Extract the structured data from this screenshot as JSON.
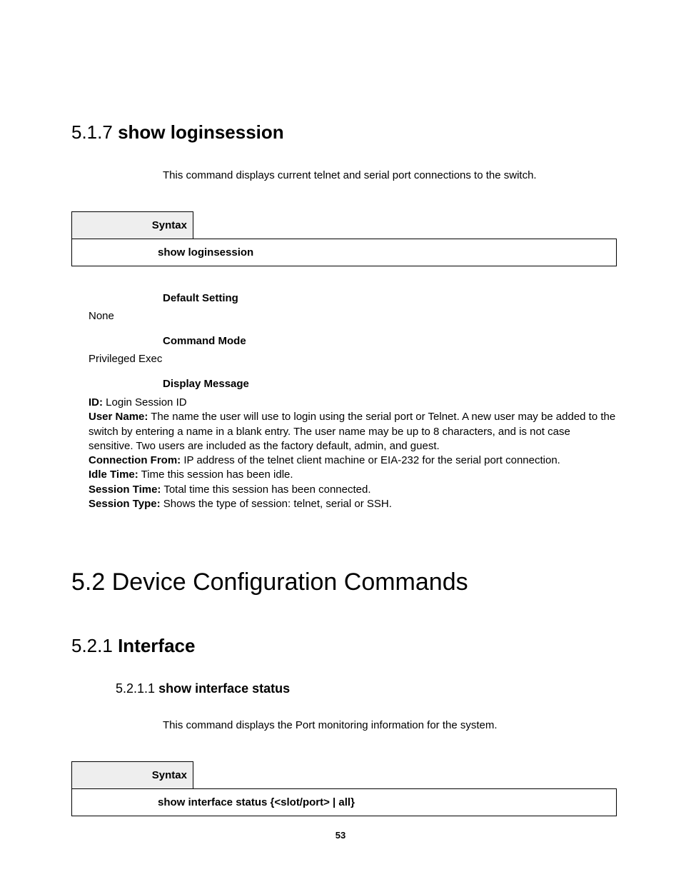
{
  "sec517": {
    "num": "5.1.7",
    "title": "show loginsession",
    "desc": "This command displays current telnet and serial port connections to the switch.",
    "syntax_label": "Syntax",
    "syntax_body": "show loginsession",
    "default_label": "Default Setting",
    "default_value": "None",
    "mode_label": "Command Mode",
    "mode_value": "Privileged Exec",
    "display_label": "Display Message",
    "msgs": {
      "id_k": "ID:",
      "id_v": " Login Session ID",
      "user_k": "User Name:",
      "user_v": " The name the user will use to login using the serial port or Telnet. A new user may be added to the switch by entering a name in a blank entry. The user name may be up to 8 characters, and is not case sensitive. Two users are included as the factory default, admin, and guest.",
      "conn_k": "Connection From:",
      "conn_v": " IP address of the telnet client machine or EIA-232 for the serial port connection.",
      "idle_k": "Idle Time:",
      "idle_v": " Time this session has been idle.",
      "sess_k": "Session Time:",
      "sess_v": " Total time this session has been connected.",
      "type_k": "Session Type:",
      "type_v": " Shows the type of session: telnet, serial or SSH."
    }
  },
  "sec52": {
    "title": "5.2 Device Configuration Commands"
  },
  "sec521": {
    "num": "5.2.1",
    "title": "Interface"
  },
  "sec5211": {
    "num": "5.2.1.1",
    "title": "show interface status",
    "desc": "This command displays the Port monitoring information for the system.",
    "syntax_label": "Syntax",
    "syntax_body": "show interface status {<slot/port> | all}"
  },
  "page_number": "53"
}
